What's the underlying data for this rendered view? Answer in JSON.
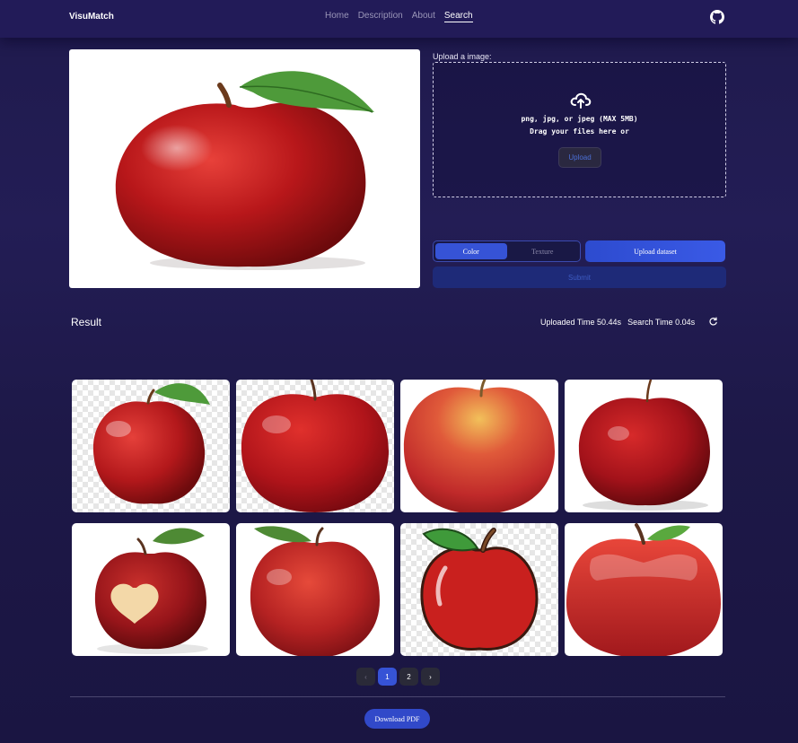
{
  "nav": {
    "brand": "VisuMatch",
    "links": [
      "Home",
      "Description",
      "About",
      "Search"
    ],
    "active": "Search",
    "github_icon": "github-icon"
  },
  "upload": {
    "label": "Upload a image:",
    "hint_line1": "png, jpg, or jpeg (MAX 5MB)",
    "hint_line2": "Drag your files here or",
    "button": "Upload",
    "icon": "cloud-upload-icon"
  },
  "controls": {
    "mode_options": [
      "Color",
      "Texture"
    ],
    "mode_selected": "Color",
    "dataset_button": "Upload dataset",
    "submit_button": "Submit"
  },
  "result": {
    "title": "Result",
    "uploaded_time": "Uploaded Time 50.44s",
    "search_time": "Search Time 0.04s",
    "refresh_icon": "refresh-icon"
  },
  "pagination": {
    "prev": "‹",
    "pages": [
      "1",
      "2"
    ],
    "current": "1",
    "next": "›"
  },
  "download_button": "Download PDF",
  "colors": {
    "accent": "#3653d6",
    "background": "#1f1a4d",
    "navbar": "#221b58"
  }
}
